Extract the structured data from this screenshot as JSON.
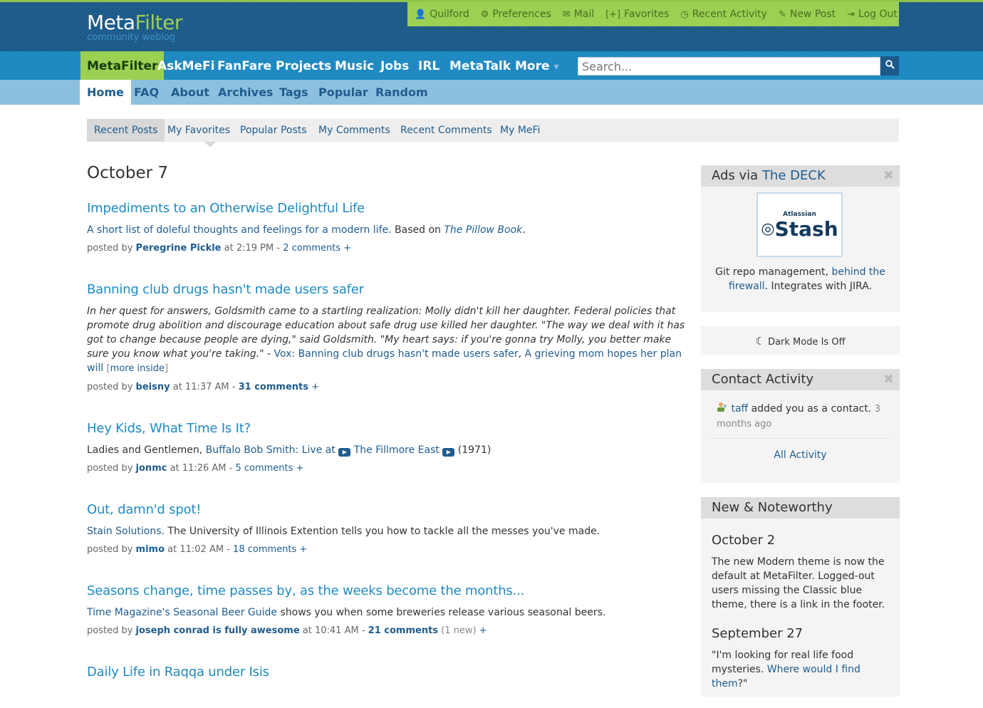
{
  "header": {
    "logo_meta": "Meta",
    "logo_filter": "Filter",
    "tagline": "community weblog"
  },
  "user_nav": [
    {
      "icon": "👤",
      "label": "Quilford"
    },
    {
      "icon": "⚙",
      "label": "Preferences"
    },
    {
      "icon": "✉",
      "label": "Mail"
    },
    {
      "icon": "[+]",
      "label": "Favorites"
    },
    {
      "icon": "◷",
      "label": "Recent Activity"
    },
    {
      "icon": "✎",
      "label": "New Post"
    },
    {
      "icon": "⇥",
      "label": "Log Out"
    }
  ],
  "main_nav": [
    "MetaFilter",
    "AskMeFi",
    "FanFare",
    "Projects",
    "Music",
    "Jobs",
    "IRL",
    "MetaTalk",
    "More"
  ],
  "main_nav_more_caret": "▾",
  "search": {
    "placeholder": "Search...",
    "icon": "🔍"
  },
  "sub_nav": [
    "Home",
    "FAQ",
    "About",
    "Archives",
    "Tags",
    "Popular",
    "Random"
  ],
  "tabs": [
    "Recent Posts",
    "My Favorites",
    "Popular Posts",
    "My Comments",
    "Recent Comments",
    "My MeFi"
  ],
  "date_heading": "October 7",
  "posts": [
    {
      "title": "Impediments to an Otherwise Delightful Life",
      "link": "A short list of doleful thoughts and feelings for a modern life.",
      "text1": " Based on ",
      "link2": "The Pillow Book",
      "text2": ".",
      "user": "Peregrine Pickle",
      "time": "at 2:19 PM",
      "comments": "2 comments"
    },
    {
      "title": "Banning club drugs hasn't made users safer",
      "text": "In her quest for answers, Goldsmith came to a startling realization: Molly didn't kill her daughter. Federal policies that promote drug abolition and discourage education about safe drug use killed her daughter. \"The way we deal with it has got to change because people are dying,\" said Goldsmith. \"My heart says: if you're gonna try Molly, you better make sure you know what you're taking.\"",
      "dash": " - ",
      "link": "Vox: Banning club drugs hasn't made users safer",
      "comma": ", ",
      "link2": "A grieving mom hopes her plan will",
      "more_inside": "more inside",
      "user": "beisny",
      "time": "at 11:37 AM",
      "comments": "31 comments"
    },
    {
      "title": "Hey Kids, What Time Is It?",
      "text1": "Ladies and Gentlemen, ",
      "link": "Buffalo Bob Smith: Live at",
      "link2": "The Fillmore East",
      "text2": " (1971)",
      "user": "jonmc",
      "time": "at 11:26 AM",
      "comments": "5 comments"
    },
    {
      "title": "Out, damn'd spot!",
      "link": "Stain Solutions.",
      "text1": " The University of Illinois Extention tells you how to tackle all the messes you've made.",
      "user": "mimo",
      "time": "at 11:02 AM",
      "comments": "18 comments"
    },
    {
      "title": "Seasons change, time passes by, as the weeks become the months...",
      "link": "Time Magazine's Seasonal Beer Guide",
      "text1": " shows you when some breweries release various seasonal beers.",
      "user": "joseph conrad is fully awesome",
      "time": "at 10:41 AM",
      "comments": "21 comments",
      "new": "(1 new)"
    },
    {
      "title": "Daily Life in Raqqa under Isis"
    }
  ],
  "meta_labels": {
    "posted_by": "posted by ",
    "sep": " - ",
    "plus": " +"
  },
  "sidebar": {
    "ads": {
      "title_prefix": "Ads via ",
      "title_link": "The DECK",
      "img_brand": "Atlassian",
      "img_product": "Stash",
      "text1": "Git repo management, ",
      "link": "behind the firewall",
      "text2": ". Integrates with JIRA."
    },
    "dark_mode": {
      "icon": "☾",
      "label": "Dark Mode Is Off"
    },
    "contact": {
      "title": "Contact Activity",
      "user": "taff",
      "text": " added you as a contact.",
      "ago": "3 months ago",
      "all": "All Activity"
    },
    "noteworthy": {
      "title": "New & Noteworthy",
      "items": [
        {
          "date": "October 2",
          "text": "The new Modern theme is now the default at MetaFilter. Logged-out users missing the Classic blue theme, there is a link in the footer."
        },
        {
          "date": "September 27",
          "text1": "\"I'm looking for real life food mysteries. ",
          "link": "Where would I find them",
          "text2": "?\""
        }
      ]
    },
    "close_icon": "✖"
  }
}
